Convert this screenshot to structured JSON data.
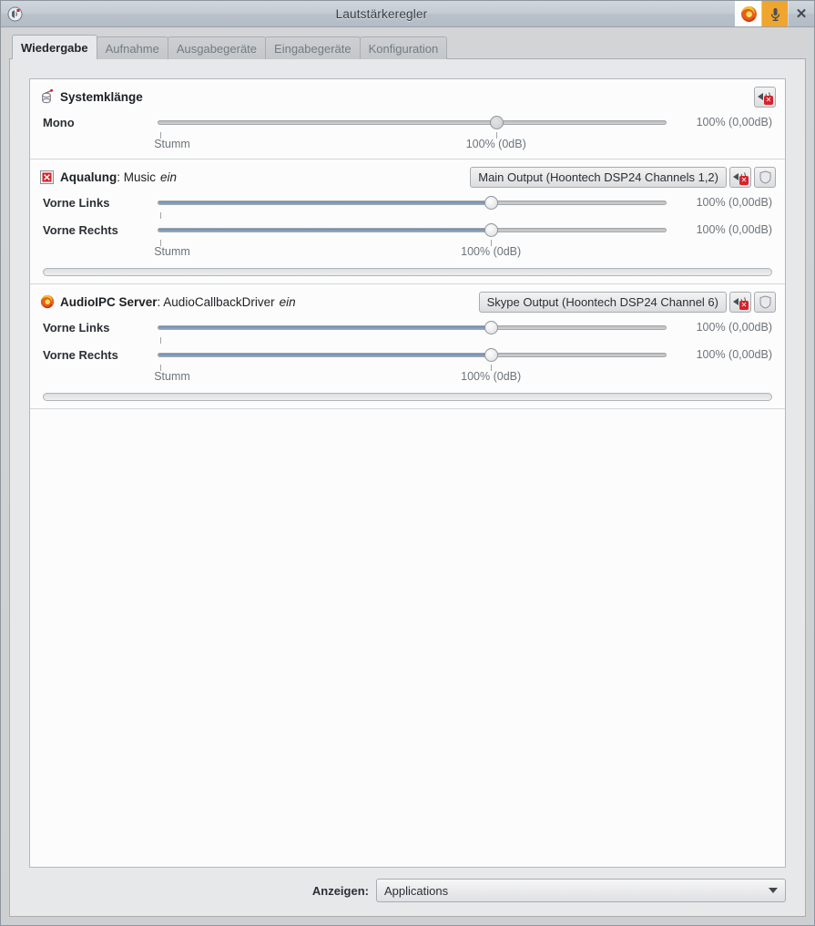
{
  "window": {
    "title": "Lautstärkeregler",
    "app_icon": "volume-control-icon",
    "titlebar_buttons": [
      {
        "name": "firefox-icon",
        "label": ""
      },
      {
        "name": "microphone-icon",
        "label": ""
      },
      {
        "name": "close-icon",
        "label": "✕"
      }
    ]
  },
  "tabs": [
    {
      "label": "Wiedergabe",
      "active": true
    },
    {
      "label": "Aufnahme",
      "active": false
    },
    {
      "label": "Ausgabegeräte",
      "active": false
    },
    {
      "label": "Eingabegeräte",
      "active": false
    },
    {
      "label": "Konfiguration",
      "active": false
    }
  ],
  "colors": {
    "slider_fill": "#6d8cb0",
    "mute_badge": "#d4232b",
    "mic_button_bg": "#f0a52e",
    "panel_bg": "#e7e8ea",
    "list_bg": "#fcfcfc"
  },
  "streams": [
    {
      "icon": "system-sounds-icon",
      "app_name": "Systemklänge",
      "stream_name": "",
      "state": "",
      "has_device_button": false,
      "device_label": "",
      "mute_button": "speaker-mute-icon",
      "has_lock_button": false,
      "lock_button": "",
      "channels": [
        {
          "label": "Mono",
          "value": "100% (0,00dB)",
          "percent": 66.5,
          "fill": false
        }
      ],
      "scale_marks": [
        {
          "label": "Stumm",
          "percent": 0.6
        },
        {
          "label": "100% (0dB)",
          "percent": 66.5
        }
      ],
      "has_meter": false
    },
    {
      "icon": "aqualung-icon",
      "app_name": "Aqualung",
      "stream_name": "Music",
      "state": "ein",
      "has_device_button": true,
      "device_label": "Main Output (Hoontech DSP24 Channels 1,2)",
      "mute_button": "speaker-mute-icon",
      "has_lock_button": true,
      "lock_button": "shield-lock-icon",
      "channels": [
        {
          "label": "Vorne Links",
          "value": "100% (0,00dB)",
          "percent": 65.5,
          "fill": true
        },
        {
          "label": "Vorne Rechts",
          "value": "100% (0,00dB)",
          "percent": 65.5,
          "fill": true
        }
      ],
      "scale_marks": [
        {
          "label": "Stumm",
          "percent": 0.6
        },
        {
          "label": "100% (0dB)",
          "percent": 65.5
        }
      ],
      "has_meter": true
    },
    {
      "icon": "audioipc-firefox-icon",
      "app_name": "AudioIPC Server",
      "stream_name": "AudioCallbackDriver",
      "state": "ein",
      "has_device_button": true,
      "device_label": "Skype Output (Hoontech DSP24 Channel 6)",
      "mute_button": "speaker-mute-icon",
      "has_lock_button": true,
      "lock_button": "shield-lock-icon",
      "channels": [
        {
          "label": "Vorne Links",
          "value": "100% (0,00dB)",
          "percent": 65.5,
          "fill": true
        },
        {
          "label": "Vorne Rechts",
          "value": "100% (0,00dB)",
          "percent": 65.5,
          "fill": true
        }
      ],
      "scale_marks": [
        {
          "label": "Stumm",
          "percent": 0.6
        },
        {
          "label": "100% (0dB)",
          "percent": 65.5
        }
      ],
      "has_meter": true
    }
  ],
  "footer": {
    "show_label": "Anzeigen:",
    "show_value": "Applications"
  }
}
